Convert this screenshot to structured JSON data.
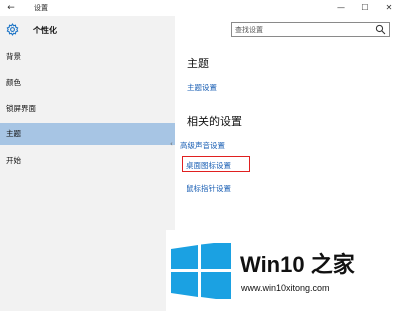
{
  "window": {
    "title": "设置",
    "back_glyph": "←",
    "minimize_glyph": "—",
    "maximize_glyph": "☐",
    "close_glyph": "✕"
  },
  "sidebar": {
    "title": "个性化",
    "items": [
      {
        "label": "背景"
      },
      {
        "label": "颜色"
      },
      {
        "label": "锁屏界面"
      },
      {
        "label": "主题",
        "active": true
      },
      {
        "label": "开始"
      }
    ]
  },
  "search": {
    "placeholder": "查找设置"
  },
  "main": {
    "section1_heading": "主题",
    "section1_link": "主题设置",
    "section2_heading": "相关的设置",
    "links": [
      "高级声音设置",
      "桌面图标设置",
      "鼠标指针设置"
    ],
    "highlighted_link_index": 1
  },
  "watermark": {
    "title": "Win10 之家",
    "url": "www.win10xitong.com"
  },
  "colors": {
    "accent": "#1a73c6",
    "active_nav": "#a7c5e4",
    "highlight_border": "#e02020",
    "link": "#1a5fb4"
  }
}
